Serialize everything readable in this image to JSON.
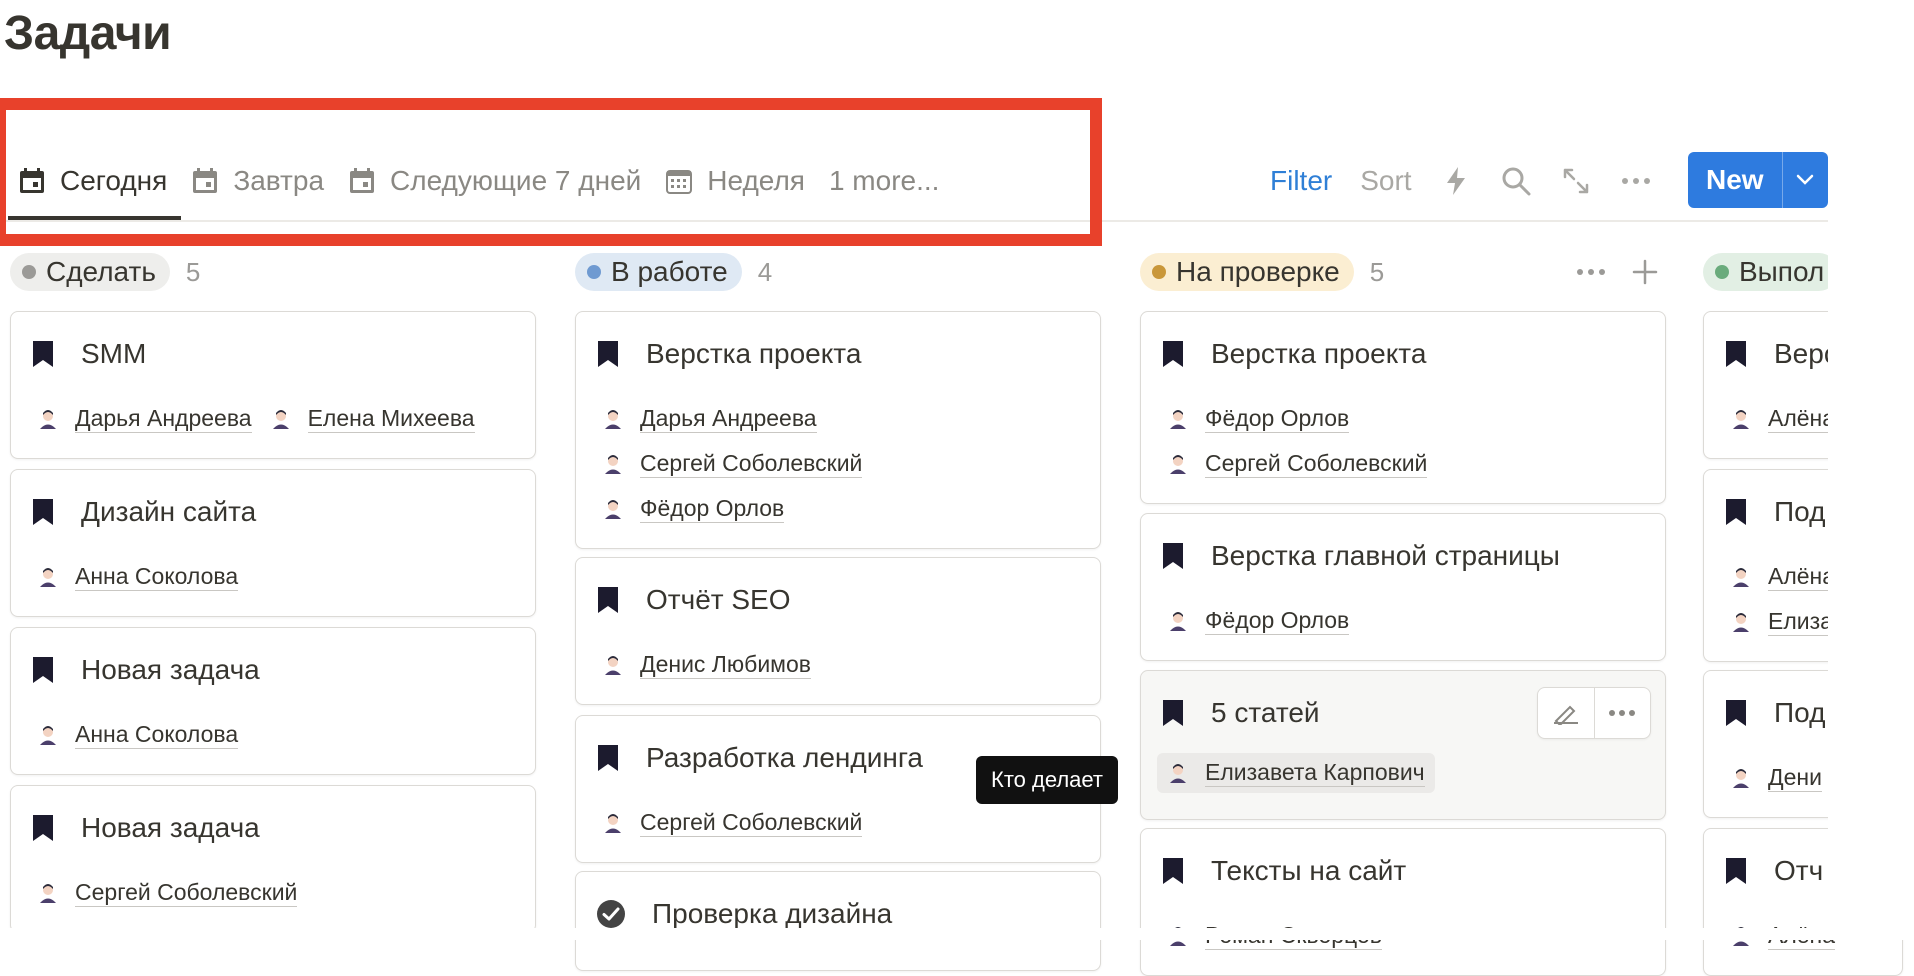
{
  "page": {
    "title": "Задачи"
  },
  "tabs": [
    {
      "label": "Сегодня",
      "icon": "calendar-icon",
      "active": true
    },
    {
      "label": "Завтра",
      "icon": "calendar-icon",
      "active": false
    },
    {
      "label": "Следующие 7 дней",
      "icon": "calendar-icon",
      "active": false
    },
    {
      "label": "Неделя",
      "icon": "calendar-grid-icon",
      "active": false
    }
  ],
  "tabs_more": "1 more...",
  "toolbar": {
    "filter": "Filter",
    "sort": "Sort",
    "new": "New"
  },
  "columns": [
    {
      "name": "Сделать",
      "count": "5",
      "dot": "#9b9a97",
      "bg": "#eeeeec"
    },
    {
      "name": "В работе",
      "count": "4",
      "dot": "#6f9ad1",
      "bg": "#dfe9f4"
    },
    {
      "name": "На проверке",
      "count": "5",
      "dot": "#c9973a",
      "bg": "#fbeed2"
    },
    {
      "name": "Выпол",
      "count": "",
      "dot": "#6aab7c",
      "bg": "#e2efe4"
    }
  ],
  "cards": {
    "c1": [
      {
        "title": "SMM",
        "people": [
          "Дарья Андреева",
          "Елена Михеева"
        ]
      },
      {
        "title": "Дизайн сайта",
        "people": [
          "Анна Соколова"
        ]
      },
      {
        "title": "Новая задача",
        "people": [
          "Анна Соколова"
        ]
      },
      {
        "title": "Новая задача",
        "people": [
          "Сергей Соболевский"
        ]
      }
    ],
    "c2": [
      {
        "title": "Верстка проекта",
        "people": [
          "Дарья Андреева",
          "Сергей Соболевский",
          "Фёдор Орлов"
        ]
      },
      {
        "title": "Отчёт SEO",
        "people": [
          "Денис Любимов"
        ]
      },
      {
        "title": "Разработка лендинга",
        "people": [
          "Сергей Соболевский"
        ]
      },
      {
        "title": "Проверка дизайна",
        "people": []
      }
    ],
    "c3": [
      {
        "title": "Верстка проекта",
        "people": [
          "Фёдор Орлов",
          "Сергей Соболевский"
        ]
      },
      {
        "title": "Верстка главной страницы",
        "people": [
          "Фёдор Орлов"
        ]
      },
      {
        "title": "5 статей",
        "people": [
          "Елизавета Карпович"
        ]
      },
      {
        "title": "Тексты на сайт",
        "people": [
          "Роман Скворцов"
        ]
      }
    ],
    "c4": [
      {
        "title": "Верс",
        "people": [
          "Алёна"
        ]
      },
      {
        "title": "Под",
        "people": [
          "Алёна",
          "Елиза"
        ]
      },
      {
        "title": "Под",
        "people": [
          "Дени"
        ]
      },
      {
        "title": "Отч",
        "people": [
          "Алёна"
        ]
      }
    ]
  },
  "tooltip": "Кто делает"
}
